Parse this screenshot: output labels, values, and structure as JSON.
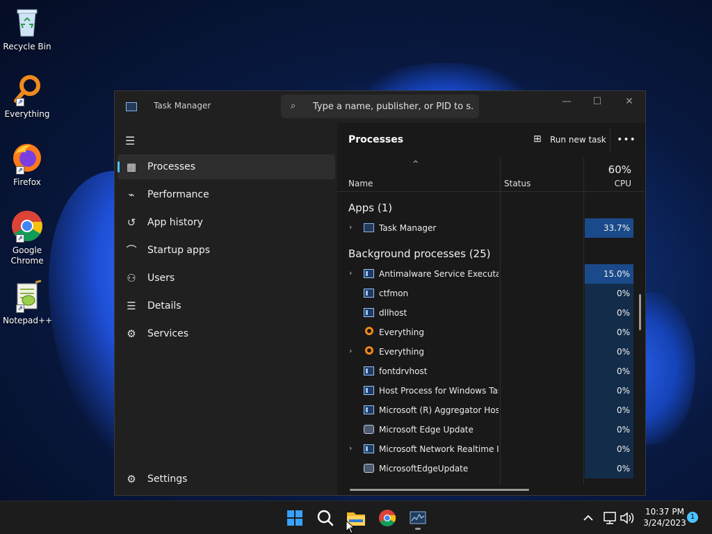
{
  "desktop": {
    "icons": [
      {
        "label": "Recycle Bin"
      },
      {
        "label": "Everything"
      },
      {
        "label": "Firefox"
      },
      {
        "label": "Google Chrome"
      },
      {
        "label": "Notepad++"
      }
    ]
  },
  "window": {
    "title": "Task Manager",
    "search_placeholder": "Type a name, publisher, or PID to s...",
    "controls": {
      "minimize": "—",
      "maximize": "☐",
      "close": "✕"
    }
  },
  "sidebar": {
    "items": [
      {
        "label": "Processes",
        "icon": "processes-icon",
        "active": true
      },
      {
        "label": "Performance",
        "icon": "performance-icon"
      },
      {
        "label": "App history",
        "icon": "app-history-icon"
      },
      {
        "label": "Startup apps",
        "icon": "startup-apps-icon"
      },
      {
        "label": "Users",
        "icon": "users-icon"
      },
      {
        "label": "Details",
        "icon": "details-icon"
      },
      {
        "label": "Services",
        "icon": "services-icon"
      }
    ],
    "settings_label": "Settings"
  },
  "main": {
    "title": "Processes",
    "run_new_task": "Run new task",
    "more": "•••",
    "columns": {
      "name": "Name",
      "status": "Status",
      "cpu_total": "60%",
      "cpu": "CPU"
    },
    "apps_header": "Apps (1)",
    "apps": [
      {
        "name": "Task Manager",
        "cpu": "33.7%",
        "expandable": true,
        "icon": "task-manager-icon"
      }
    ],
    "bg_header": "Background processes (25)",
    "background": [
      {
        "name": "Antimalware Service Executable",
        "cpu": "15.0%",
        "expandable": true,
        "icon": "exe"
      },
      {
        "name": "ctfmon",
        "cpu": "0%",
        "expandable": false,
        "icon": "exe"
      },
      {
        "name": "dllhost",
        "cpu": "0%",
        "expandable": false,
        "icon": "exe"
      },
      {
        "name": "Everything",
        "cpu": "0%",
        "expandable": false,
        "icon": "everything"
      },
      {
        "name": "Everything",
        "cpu": "0%",
        "expandable": true,
        "icon": "everything"
      },
      {
        "name": "fontdrvhost",
        "cpu": "0%",
        "expandable": false,
        "icon": "exe"
      },
      {
        "name": "Host Process for Windows Tasks",
        "cpu": "0%",
        "expandable": false,
        "icon": "exe"
      },
      {
        "name": "Microsoft (R) Aggregator Host",
        "cpu": "0%",
        "expandable": false,
        "icon": "exe"
      },
      {
        "name": "Microsoft Edge Update",
        "cpu": "0%",
        "expandable": false,
        "icon": "edge"
      },
      {
        "name": "Microsoft Network Realtime I...",
        "cpu": "0%",
        "expandable": true,
        "icon": "exe"
      },
      {
        "name": "MicrosoftEdgeUpdate",
        "cpu": "0%",
        "expandable": false,
        "icon": "edge"
      }
    ]
  },
  "taskbar": {
    "time": "10:37 PM",
    "date": "3/24/2023",
    "notification_count": "1"
  }
}
